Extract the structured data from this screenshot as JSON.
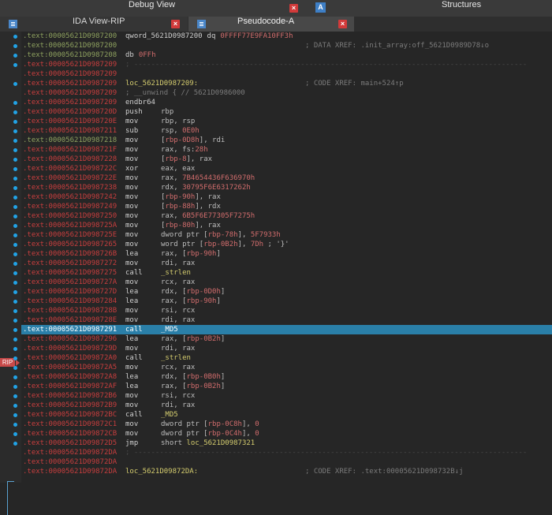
{
  "window": {
    "debug_view": "Debug View",
    "structures": "Structures",
    "structures_icon": "A"
  },
  "tabs": [
    {
      "label": "IDA View-RIP",
      "active": false
    },
    {
      "label": "Pseudocode-A",
      "active": true
    }
  ],
  "close_glyph": "×",
  "rip_label": "RIP",
  "lines": [
    {
      "addr": ".text:00005621D0987200",
      "ac": "g",
      "dot": true,
      "t": "data",
      "name": "qword_5621D0987200",
      "dir": "dq",
      "val": "0FFFF77E9FA10FF3h"
    },
    {
      "addr": ".text:00005621D0987200",
      "ac": "g",
      "dot": true,
      "t": "cmt",
      "comment": "; DATA XREF: .init_array:off_5621D0989D78↓o"
    },
    {
      "addr": ".text:00005621D0987208",
      "ac": "g",
      "dot": true,
      "t": "db",
      "dir": "db",
      "val": "0FFh"
    },
    {
      "addr": ".text:00005621D0987209",
      "ac": "r",
      "dot": true,
      "t": "sep"
    },
    {
      "addr": ".text:00005621D0987209",
      "ac": "r",
      "dot": false,
      "t": "blank"
    },
    {
      "addr": ".text:00005621D0987209",
      "ac": "r",
      "dot": true,
      "t": "label",
      "label": "loc_5621D0987209:",
      "comment": "; CODE XREF: main+524↑p"
    },
    {
      "addr": ".text:00005621D0987209",
      "ac": "r",
      "dot": false,
      "t": "unwind",
      "text": "; __unwind { // 5621D0986000"
    },
    {
      "addr": ".text:00005621D0987209",
      "ac": "r",
      "dot": true,
      "t": "ins",
      "mn": "endbr64",
      "ops": []
    },
    {
      "addr": ".text:00005621D098720D",
      "ac": "r",
      "dot": true,
      "t": "ins",
      "mn": "push",
      "ops": [
        [
          "r",
          "rbp"
        ]
      ]
    },
    {
      "addr": ".text:00005621D098720E",
      "ac": "r",
      "dot": true,
      "t": "ins",
      "mn": "mov",
      "ops": [
        [
          "r",
          "rbp, rsp"
        ]
      ]
    },
    {
      "addr": ".text:00005621D0987211",
      "ac": "r",
      "dot": true,
      "t": "ins",
      "mn": "sub",
      "ops": [
        [
          "r",
          "rsp, "
        ],
        [
          "n",
          "0E0h"
        ]
      ]
    },
    {
      "addr": ".text:00005621D0987218",
      "ac": "g",
      "dot": true,
      "t": "ins",
      "mn": "mov",
      "ops": [
        [
          "r",
          "["
        ],
        [
          "n",
          "rbp-0D8h"
        ],
        [
          "r",
          "], rdi"
        ]
      ]
    },
    {
      "addr": ".text:00005621D098721F",
      "ac": "r",
      "dot": true,
      "t": "ins",
      "mn": "mov",
      "ops": [
        [
          "r",
          "rax, fs:"
        ],
        [
          "n",
          "28h"
        ]
      ]
    },
    {
      "addr": ".text:00005621D0987228",
      "ac": "r",
      "dot": true,
      "t": "ins",
      "mn": "mov",
      "ops": [
        [
          "r",
          "["
        ],
        [
          "n",
          "rbp-8"
        ],
        [
          "r",
          "], rax"
        ]
      ]
    },
    {
      "addr": ".text:00005621D098722C",
      "ac": "r",
      "dot": true,
      "t": "ins",
      "mn": "xor",
      "ops": [
        [
          "r",
          "eax, eax"
        ]
      ]
    },
    {
      "addr": ".text:00005621D098722E",
      "ac": "r",
      "dot": true,
      "t": "ins",
      "mn": "mov",
      "ops": [
        [
          "r",
          "rax, "
        ],
        [
          "n",
          "7B4654436F636970h"
        ]
      ]
    },
    {
      "addr": ".text:00005621D0987238",
      "ac": "r",
      "dot": true,
      "t": "ins",
      "mn": "mov",
      "ops": [
        [
          "r",
          "rdx, "
        ],
        [
          "n",
          "30795F6E6317262h"
        ]
      ]
    },
    {
      "addr": ".text:00005621D0987242",
      "ac": "r",
      "dot": true,
      "t": "ins",
      "mn": "mov",
      "ops": [
        [
          "r",
          "["
        ],
        [
          "n",
          "rbp-90h"
        ],
        [
          "r",
          "], rax"
        ]
      ]
    },
    {
      "addr": ".text:00005621D0987249",
      "ac": "r",
      "dot": true,
      "t": "ins",
      "mn": "mov",
      "ops": [
        [
          "r",
          "["
        ],
        [
          "n",
          "rbp-88h"
        ],
        [
          "r",
          "], rdx"
        ]
      ]
    },
    {
      "addr": ".text:00005621D0987250",
      "ac": "r",
      "dot": true,
      "t": "ins",
      "mn": "mov",
      "ops": [
        [
          "r",
          "rax, "
        ],
        [
          "n",
          "6B5F6E77305F7275h"
        ]
      ]
    },
    {
      "addr": ".text:00005621D098725A",
      "ac": "r",
      "dot": true,
      "t": "ins",
      "mn": "mov",
      "ops": [
        [
          "r",
          "["
        ],
        [
          "n",
          "rbp-80h"
        ],
        [
          "r",
          "], rax"
        ]
      ]
    },
    {
      "addr": ".text:00005621D098725E",
      "ac": "r",
      "dot": true,
      "t": "ins",
      "mn": "mov",
      "ops": [
        [
          "r",
          "dword ptr ["
        ],
        [
          "n",
          "rbp-78h"
        ],
        [
          "r",
          "], "
        ],
        [
          "n",
          "5F7933h"
        ]
      ]
    },
    {
      "addr": ".text:00005621D0987265",
      "ac": "r",
      "dot": true,
      "t": "ins",
      "mn": "mov",
      "ops": [
        [
          "r",
          "word ptr ["
        ],
        [
          "n",
          "rbp-0B2h"
        ],
        [
          "r",
          "], "
        ],
        [
          "n",
          "7Dh"
        ],
        [
          "r",
          " ; '}'"
        ]
      ]
    },
    {
      "addr": ".text:00005621D098726B",
      "ac": "r",
      "dot": true,
      "t": "ins",
      "mn": "lea",
      "ops": [
        [
          "r",
          "rax, ["
        ],
        [
          "n",
          "rbp-90h"
        ],
        [
          "r",
          "]"
        ]
      ]
    },
    {
      "addr": ".text:00005621D0987272",
      "ac": "r",
      "dot": true,
      "t": "ins",
      "mn": "mov",
      "ops": [
        [
          "r",
          "rdi, rax"
        ]
      ]
    },
    {
      "addr": ".text:00005621D0987275",
      "ac": "r",
      "dot": true,
      "t": "ins",
      "mn": "call",
      "ops": [
        [
          "s",
          "_strlen"
        ]
      ]
    },
    {
      "addr": ".text:00005621D098727A",
      "ac": "r",
      "dot": true,
      "t": "ins",
      "mn": "mov",
      "ops": [
        [
          "r",
          "rcx, rax"
        ]
      ]
    },
    {
      "addr": ".text:00005621D098727D",
      "ac": "r",
      "dot": true,
      "t": "ins",
      "mn": "lea",
      "ops": [
        [
          "r",
          "rdx, ["
        ],
        [
          "n",
          "rbp-0D0h"
        ],
        [
          "r",
          "]"
        ]
      ]
    },
    {
      "addr": ".text:00005621D0987284",
      "ac": "r",
      "dot": true,
      "t": "ins",
      "mn": "lea",
      "ops": [
        [
          "r",
          "rax, ["
        ],
        [
          "n",
          "rbp-90h"
        ],
        [
          "r",
          "]"
        ]
      ]
    },
    {
      "addr": ".text:00005621D098728B",
      "ac": "r",
      "dot": true,
      "t": "ins",
      "mn": "mov",
      "ops": [
        [
          "r",
          "rsi, rcx"
        ]
      ]
    },
    {
      "addr": ".text:00005621D098728E",
      "ac": "r",
      "dot": true,
      "t": "ins",
      "mn": "mov",
      "ops": [
        [
          "r",
          "rdi, rax"
        ]
      ]
    },
    {
      "addr": ".text:00005621D0987291",
      "ac": "r",
      "dot": true,
      "t": "ins",
      "mn": "call",
      "ops": [
        [
          "s",
          "_MD5"
        ]
      ],
      "hl": true
    },
    {
      "addr": ".text:00005621D0987296",
      "ac": "r",
      "dot": true,
      "t": "ins",
      "mn": "lea",
      "ops": [
        [
          "r",
          "rax, ["
        ],
        [
          "n",
          "rbp-0B2h"
        ],
        [
          "r",
          "]"
        ]
      ]
    },
    {
      "addr": ".text:00005621D098729D",
      "ac": "r",
      "dot": true,
      "t": "ins",
      "mn": "mov",
      "ops": [
        [
          "r",
          "rdi, rax"
        ]
      ]
    },
    {
      "addr": ".text:00005621D09872A0",
      "ac": "r",
      "dot": true,
      "t": "ins",
      "mn": "call",
      "ops": [
        [
          "s",
          "_strlen"
        ]
      ]
    },
    {
      "addr": ".text:00005621D09872A5",
      "ac": "r",
      "dot": true,
      "t": "ins",
      "mn": "mov",
      "ops": [
        [
          "r",
          "rcx, rax"
        ]
      ]
    },
    {
      "addr": ".text:00005621D09872A8",
      "ac": "r",
      "dot": true,
      "t": "ins",
      "mn": "lea",
      "ops": [
        [
          "r",
          "rdx, ["
        ],
        [
          "n",
          "rbp-0B0h"
        ],
        [
          "r",
          "]"
        ]
      ]
    },
    {
      "addr": ".text:00005621D09872AF",
      "ac": "r",
      "dot": true,
      "t": "ins",
      "mn": "lea",
      "ops": [
        [
          "r",
          "rax, ["
        ],
        [
          "n",
          "rbp-0B2h"
        ],
        [
          "r",
          "]"
        ]
      ]
    },
    {
      "addr": ".text:00005621D09872B6",
      "ac": "r",
      "dot": true,
      "t": "ins",
      "mn": "mov",
      "ops": [
        [
          "r",
          "rsi, rcx"
        ]
      ]
    },
    {
      "addr": ".text:00005621D09872B9",
      "ac": "r",
      "dot": true,
      "t": "ins",
      "mn": "mov",
      "ops": [
        [
          "r",
          "rdi, rax"
        ]
      ]
    },
    {
      "addr": ".text:00005621D09872BC",
      "ac": "r",
      "dot": true,
      "t": "ins",
      "mn": "call",
      "ops": [
        [
          "s",
          "_MD5"
        ]
      ]
    },
    {
      "addr": ".text:00005621D09872C1",
      "ac": "r",
      "dot": true,
      "t": "ins",
      "mn": "mov",
      "ops": [
        [
          "r",
          "dword ptr ["
        ],
        [
          "n",
          "rbp-0C8h"
        ],
        [
          "r",
          "], "
        ],
        [
          "n",
          "0"
        ]
      ]
    },
    {
      "addr": ".text:00005621D09872CB",
      "ac": "r",
      "dot": true,
      "t": "ins",
      "mn": "mov",
      "ops": [
        [
          "r",
          "dword ptr ["
        ],
        [
          "n",
          "rbp-0C4h"
        ],
        [
          "r",
          "], "
        ],
        [
          "n",
          "0"
        ]
      ]
    },
    {
      "addr": ".text:00005621D09872D5",
      "ac": "r",
      "dot": true,
      "t": "ins",
      "mn": "jmp",
      "ops": [
        [
          "r",
          "short "
        ],
        [
          "s",
          "loc_5621D0987321"
        ]
      ]
    },
    {
      "addr": ".text:00005621D09872DA",
      "ac": "r",
      "dot": false,
      "t": "sep"
    },
    {
      "addr": ".text:00005621D09872DA",
      "ac": "r",
      "dot": false,
      "t": "blank"
    },
    {
      "addr": ".text:00005621D09872DA",
      "ac": "r",
      "dot": false,
      "t": "label",
      "label": "loc_5621D09872DA:",
      "comment": "; CODE XREF: .text:00005621D098732B↓j"
    }
  ]
}
